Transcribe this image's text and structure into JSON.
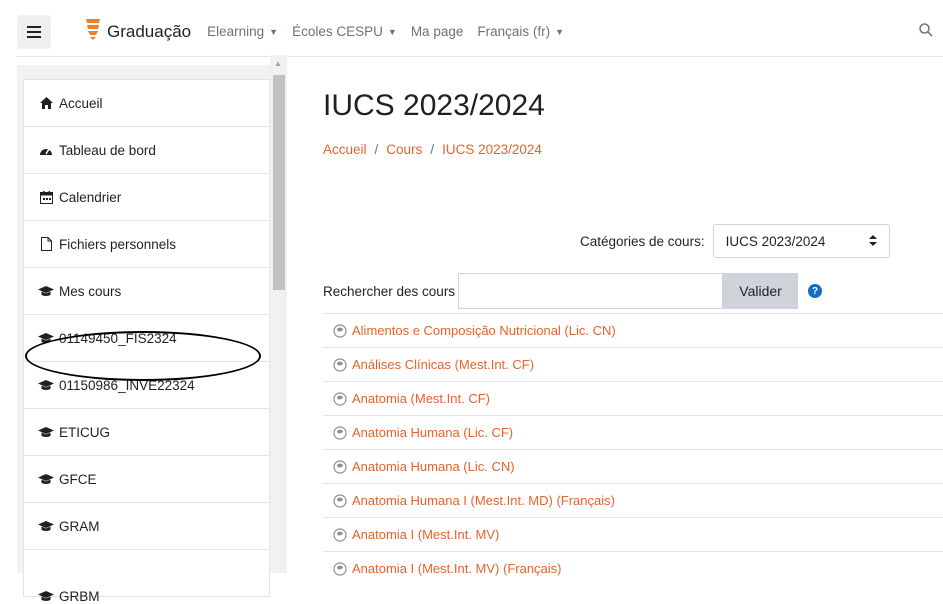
{
  "brand": {
    "name": "Graduação"
  },
  "nav": {
    "links": [
      {
        "label": "Elearning",
        "has_caret": true
      },
      {
        "label": "Écoles CESPU",
        "has_caret": true
      },
      {
        "label": "Ma page",
        "has_caret": false
      },
      {
        "label": "Français (fr)",
        "has_caret": true
      }
    ],
    "icons": {
      "menu": "hamburger-icon",
      "search": "search-icon",
      "logo": "brand-logo-icon"
    }
  },
  "sidebar": {
    "items": [
      {
        "label": "Accueil",
        "icon": "home-icon"
      },
      {
        "label": "Tableau de bord",
        "icon": "dashboard-icon"
      },
      {
        "label": "Calendrier",
        "icon": "calendar-icon"
      },
      {
        "label": "Fichiers personnels",
        "icon": "file-icon"
      },
      {
        "label": "Mes cours",
        "icon": "graduation-cap-icon"
      },
      {
        "label": "01149450_FIS2324",
        "icon": "graduation-cap-icon"
      },
      {
        "label": "01150986_INVE22324",
        "icon": "graduation-cap-icon"
      },
      {
        "label": "ETICUG",
        "icon": "graduation-cap-icon"
      },
      {
        "label": "GFCE",
        "icon": "graduation-cap-icon"
      },
      {
        "label": "GRAM",
        "icon": "graduation-cap-icon"
      },
      {
        "label": "GRBM",
        "icon": "graduation-cap-icon"
      }
    ]
  },
  "main": {
    "title": "IUCS 2023/2024",
    "breadcrumb": [
      "Accueil",
      "Cours",
      "IUCS 2023/2024"
    ],
    "categories_label": "Catégories de cours:",
    "categories_selected": "IUCS 2023/2024",
    "search_label": "Rechercher des cours",
    "search_value": "",
    "search_button": "Valider",
    "courses": [
      "Alimentos e Composição Nutricional (Lic. CN)",
      "Análises Clínicas (Mest.Int. CF)",
      "Anatomia (Mest.Int. CF)",
      "Anatomia Humana (Lic. CF)",
      "Anatomia Humana (Lic. CN)",
      "Anatomia Humana I (Mest.Int. MD) (Français)",
      "Anatomia I (Mest.Int. MV)",
      "Anatomia I (Mest.Int. MV) (Français)"
    ]
  },
  "colors": {
    "accent": "#e8622a",
    "help": "#0f6fc5",
    "button": "#ced4da"
  }
}
